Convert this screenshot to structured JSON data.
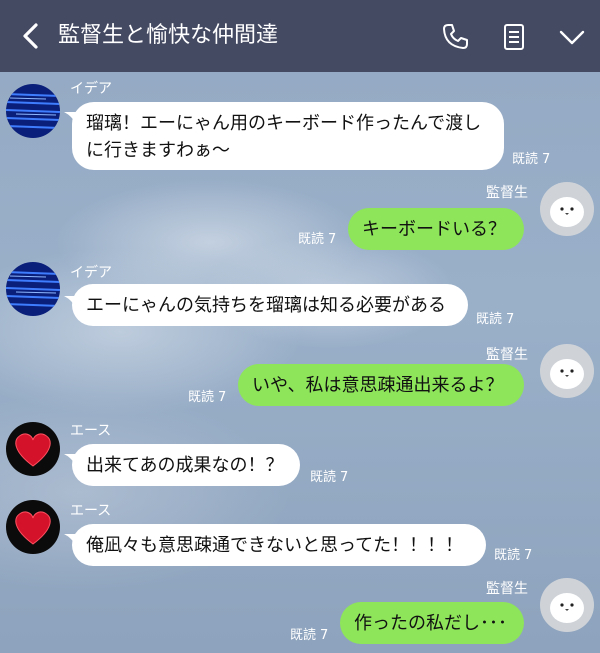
{
  "header": {
    "title": "監督生と愉快な仲間達",
    "icons": [
      "back-chevron-icon",
      "phone-icon",
      "notes-icon",
      "chevron-down-icon"
    ]
  },
  "colors": {
    "header_bg": "#454a63",
    "incoming_bubble": "#ffffff",
    "outgoing_bubble": "#8ee55a",
    "chat_bg": "#8fa4bf"
  },
  "messages": [
    {
      "sender": "イデア",
      "text_line1": "瑠璃！エーにゃん用のキーボード作ったんで渡し",
      "text_line2": "に行きますわぁ～",
      "read": "既読",
      "read_count": "7"
    },
    {
      "sender": "監督生",
      "text": "キーボードいる？",
      "read": "既読",
      "read_count": "7"
    },
    {
      "sender": "イデア",
      "text": "エーにゃんの気持ちを瑠璃は知る必要がある",
      "read": "既読",
      "read_count": "7"
    },
    {
      "sender": "監督生",
      "text": "いや、私は意思疎通出来るよ？",
      "read": "既読",
      "read_count": "7"
    },
    {
      "sender": "エース",
      "text": "出来てあの成果なの！？",
      "read": "既読",
      "read_count": "7"
    },
    {
      "sender": "エース",
      "text": "俺凪々も意思疎通できないと思ってた！！！！",
      "read": "既読",
      "read_count": "7"
    },
    {
      "sender": "監督生",
      "text": "作ったの私だし･･･",
      "read": "既読",
      "read_count": "7"
    }
  ]
}
